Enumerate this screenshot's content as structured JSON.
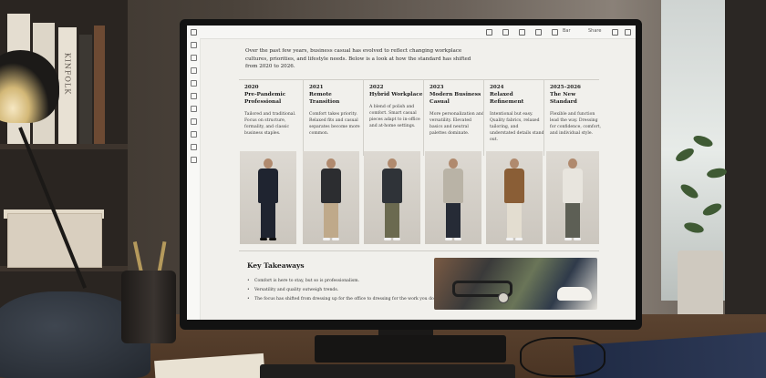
{
  "intro": "Over the past few years, business casual has evolved to reflect changing workplace cultures, priorities, and lifestyle needs. Below is a look at how the standard has shifted from 2020 to 2026.",
  "timeline": [
    {
      "year": "2020",
      "era": "Pre-Pandemic Professional",
      "desc": "Tailored and traditional. Focus on structure, formality, and classic business staples."
    },
    {
      "year": "2021",
      "era": "Remote Transition",
      "desc": "Comfort takes priority. Relaxed fits and casual separates become more common."
    },
    {
      "year": "2022",
      "era": "Hybrid Workplace",
      "desc": "A blend of polish and comfort. Smart casual pieces adapt to in-office and at-home settings."
    },
    {
      "year": "2023",
      "era": "Modern Business Casual",
      "desc": "More personalization and versatility. Elevated basics and neutral palettes dominate."
    },
    {
      "year": "2024",
      "era": "Relaxed Refinement",
      "desc": "Intentional but easy. Quality fabrics, relaxed tailoring, and understated details stand out."
    },
    {
      "year": "2025–2026",
      "era": "The New Standard",
      "desc": "Flexible and function lead the way. Dressing for confidence, comfort, and individual style."
    }
  ],
  "takeaways": {
    "title": "Key Takeaways",
    "items": [
      "Comfort is here to stay, but so is professionalism.",
      "Versatility and quality outweigh trends.",
      "The focus has shifted from dressing up for the office to dressing for the work you do."
    ]
  },
  "toolbar": {
    "left_label": "",
    "mid_label": "Bar",
    "share_label": "Share"
  },
  "bookspine": "KINFOLK",
  "colors": {
    "screen_bg": "#f1f0ec",
    "text": "#2a2a2a"
  }
}
